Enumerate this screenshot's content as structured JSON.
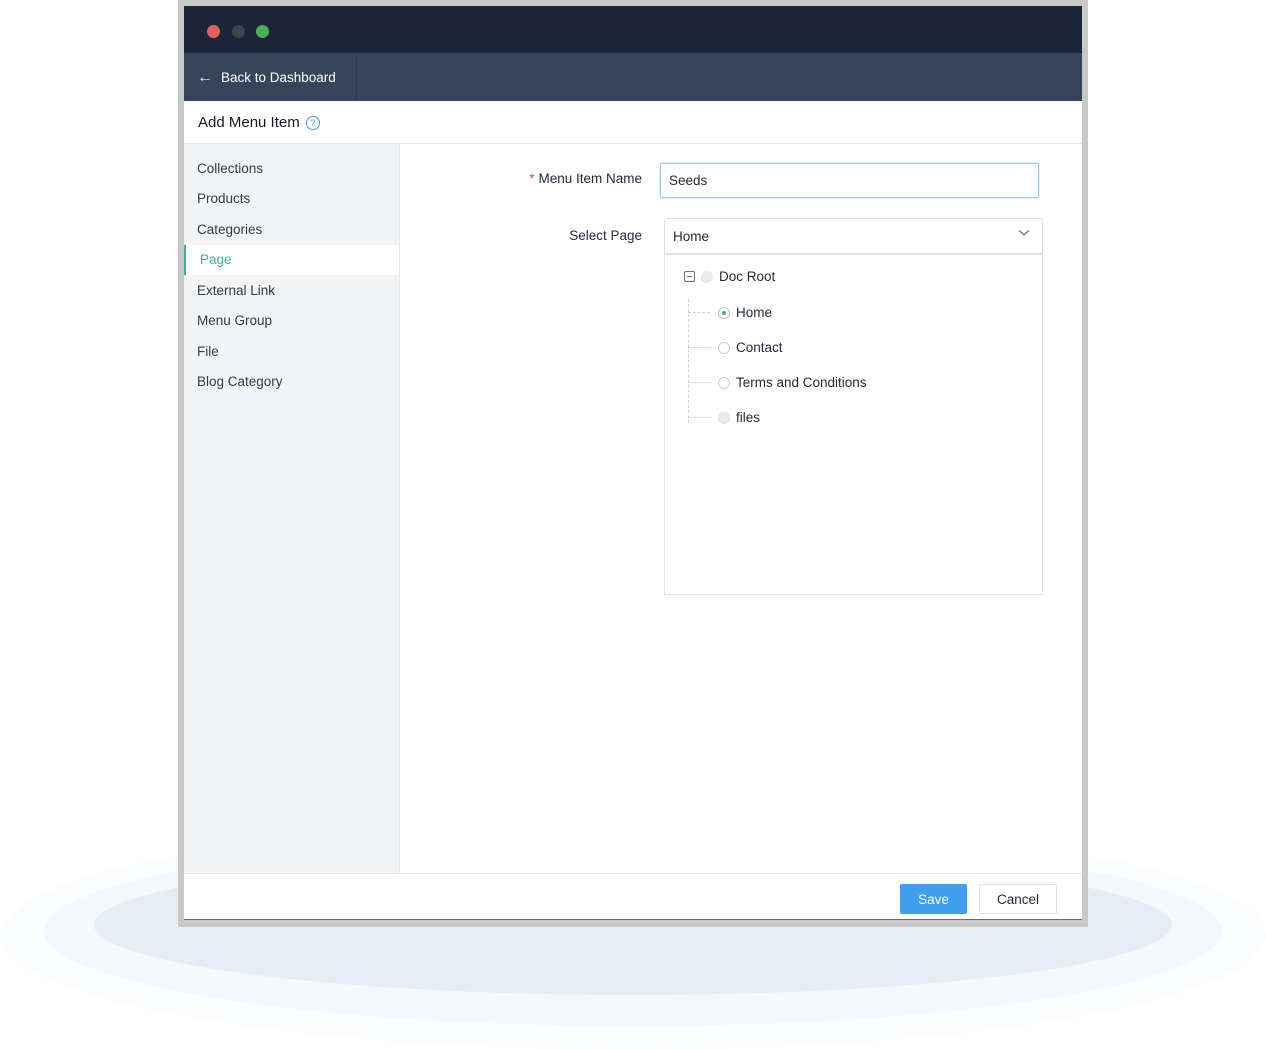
{
  "window": {
    "traffic_lights": [
      "close",
      "minimize",
      "maximize"
    ]
  },
  "nav": {
    "back_icon": "arrow-left-icon",
    "back_label": "Back to Dashboard"
  },
  "page": {
    "title": "Add Menu Item",
    "help_icon": "question-circle-icon",
    "help_glyph": "?"
  },
  "sidebar": {
    "active": "Page",
    "items": [
      {
        "label": "Collections"
      },
      {
        "label": "Products"
      },
      {
        "label": "Categories"
      },
      {
        "label": "Page"
      },
      {
        "label": "External Link"
      },
      {
        "label": "Menu Group"
      },
      {
        "label": "File"
      },
      {
        "label": "Blog Category"
      }
    ]
  },
  "form": {
    "required_marker": "*",
    "name_label": "Menu Item Name",
    "name_value": "Seeds",
    "page_label": "Select Page",
    "page_value": "Home",
    "tree": {
      "root": {
        "label": "Doc Root",
        "expanded": true,
        "disabled": true
      },
      "children": [
        {
          "label": "Home",
          "checked": true,
          "disabled": false
        },
        {
          "label": "Contact",
          "checked": false,
          "disabled": false
        },
        {
          "label": "Terms and Conditions",
          "checked": false,
          "disabled": false
        },
        {
          "label": "files",
          "checked": false,
          "disabled": true
        }
      ]
    }
  },
  "footer": {
    "save_label": "Save",
    "cancel_label": "Cancel"
  },
  "colors": {
    "accent": "#3bb39a",
    "primary_button": "#409ef1",
    "titlebar": "#1c2538",
    "navbar": "#364559",
    "required": "#e0474c"
  }
}
